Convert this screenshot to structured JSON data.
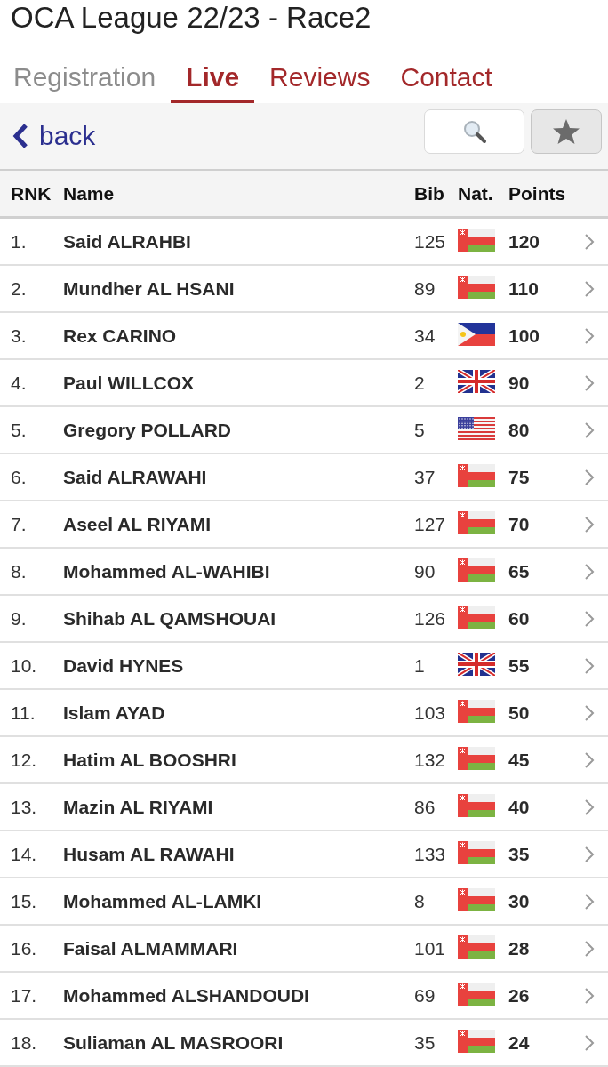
{
  "title": "OCA League 22/23 - Race2",
  "tabs": [
    {
      "label": "Registration",
      "selected": false,
      "disabled": true
    },
    {
      "label": "Live",
      "selected": true,
      "disabled": false
    },
    {
      "label": "Reviews",
      "selected": false,
      "disabled": false
    },
    {
      "label": "Contact",
      "selected": false,
      "disabled": false
    }
  ],
  "toolbar": {
    "back": "back"
  },
  "table": {
    "columns": [
      "RNK",
      "Name",
      "Bib",
      "Nat.",
      "Points"
    ],
    "rows": [
      {
        "rank": "1.",
        "name": "Said ALRAHBI",
        "bib": "125",
        "flag": {
          "kind": "oman"
        },
        "points": "120"
      },
      {
        "rank": "2.",
        "name": "Mundher AL HSANI",
        "bib": "89",
        "flag": {
          "kind": "oman"
        },
        "points": "110"
      },
      {
        "rank": "3.",
        "name": "Rex CARINO",
        "bib": "34",
        "flag": {
          "kind": "philippines"
        },
        "points": "100"
      },
      {
        "rank": "4.",
        "name": "Paul WILLCOX",
        "bib": "2",
        "flag": {
          "kind": "uk"
        },
        "points": "90"
      },
      {
        "rank": "5.",
        "name": "Gregory POLLARD",
        "bib": "5",
        "flag": {
          "kind": "usa"
        },
        "points": "80"
      },
      {
        "rank": "6.",
        "name": "Said ALRAWAHI",
        "bib": "37",
        "flag": {
          "kind": "oman"
        },
        "points": "75"
      },
      {
        "rank": "7.",
        "name": "Aseel AL RIYAMI",
        "bib": "127",
        "flag": {
          "kind": "oman"
        },
        "points": "70"
      },
      {
        "rank": "8.",
        "name": "Mohammed AL-WAHIBI",
        "bib": "90",
        "flag": {
          "kind": "oman"
        },
        "points": "65"
      },
      {
        "rank": "9.",
        "name": "Shihab AL QAMSHOUAI",
        "bib": "126",
        "flag": {
          "kind": "oman"
        },
        "points": "60"
      },
      {
        "rank": "10.",
        "name": "David HYNES",
        "bib": "1",
        "flag": {
          "kind": "uk"
        },
        "points": "55"
      },
      {
        "rank": "11.",
        "name": "Islam AYAD",
        "bib": "103",
        "flag": {
          "kind": "oman"
        },
        "points": "50"
      },
      {
        "rank": "12.",
        "name": "Hatim AL BOOSHRI",
        "bib": "132",
        "flag": {
          "kind": "oman"
        },
        "points": "45"
      },
      {
        "rank": "13.",
        "name": "Mazin AL RIYAMI",
        "bib": "86",
        "flag": {
          "kind": "oman"
        },
        "points": "40"
      },
      {
        "rank": "14.",
        "name": "Husam AL RAWAHI",
        "bib": "133",
        "flag": {
          "kind": "oman"
        },
        "points": "35"
      },
      {
        "rank": "15.",
        "name": "Mohammed AL-LAMKI",
        "bib": "8",
        "flag": {
          "kind": "oman"
        },
        "points": "30"
      },
      {
        "rank": "16.",
        "name": "Faisal ALMAMMARI",
        "bib": "101",
        "flag": {
          "kind": "oman"
        },
        "points": "28"
      },
      {
        "rank": "17.",
        "name": "Mohammed ALSHANDOUDI",
        "bib": "69",
        "flag": {
          "kind": "oman"
        },
        "points": "26"
      },
      {
        "rank": "18.",
        "name": "Suliaman AL MASROORI",
        "bib": "35",
        "flag": {
          "kind": "oman"
        },
        "points": "24"
      }
    ]
  }
}
